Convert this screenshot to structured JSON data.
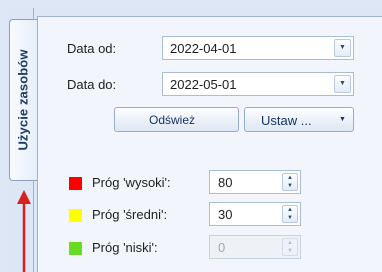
{
  "vertical_tab": {
    "label": "Użycie zasobów"
  },
  "form": {
    "date_from": {
      "label": "Data od:",
      "value": "2022-04-01"
    },
    "date_to": {
      "label": "Data do:",
      "value": "2022-05-01"
    },
    "refresh_button": "Odśwież",
    "set_button": "Ustaw ..."
  },
  "thresholds": [
    {
      "label": "Próg 'wysoki':",
      "value": "80",
      "color": "#ff0000",
      "enabled": true
    },
    {
      "label": "Próg 'średni':",
      "value": "30",
      "color": "#ffff00",
      "enabled": true
    },
    {
      "label": "Próg 'niski':",
      "value": "0",
      "color": "#66dd22",
      "enabled": false
    }
  ],
  "colors": {
    "accent": "#2b579a",
    "arrow": "#d92020"
  }
}
